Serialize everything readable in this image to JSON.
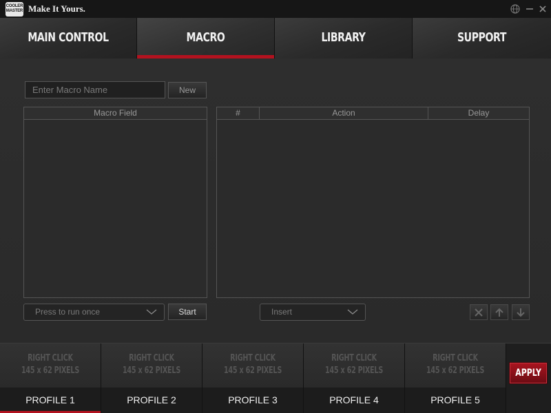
{
  "app": {
    "logo_text": "COOLER MASTER",
    "tagline": "Make It Yours."
  },
  "window_controls": {
    "language": "globe-icon",
    "minimize": "minimize-icon",
    "close": "close-icon"
  },
  "nav": {
    "tabs": [
      {
        "label": "MAIN CONTROL",
        "active": false
      },
      {
        "label": "MACRO",
        "active": true
      },
      {
        "label": "LIBRARY",
        "active": false
      },
      {
        "label": "SUPPORT",
        "active": false
      }
    ]
  },
  "macro": {
    "name_placeholder": "Enter Macro Name",
    "new_label": "New",
    "field_header": "Macro Field",
    "table": {
      "columns": [
        "#",
        "Action",
        "Delay"
      ],
      "rows": []
    },
    "run_mode_selected": "Press to run once",
    "start_label": "Start",
    "insert_selected": "Insert",
    "row_tools": [
      "close-icon",
      "arrow-up-icon",
      "arrow-down-icon"
    ]
  },
  "profiles": {
    "thumbnail_text_line1": "RIGHT CLICK",
    "thumbnail_text_line2": "145 x 62 PIXELS",
    "items": [
      {
        "label": "PROFILE 1",
        "active": true
      },
      {
        "label": "PROFILE 2",
        "active": false
      },
      {
        "label": "PROFILE 3",
        "active": false
      },
      {
        "label": "PROFILE 4",
        "active": false
      },
      {
        "label": "PROFILE 5",
        "active": false
      }
    ],
    "apply_label": "APPLY"
  },
  "colors": {
    "accent": "#b3121f",
    "background": "#2c2c2c",
    "text": "#f0f0f0"
  }
}
